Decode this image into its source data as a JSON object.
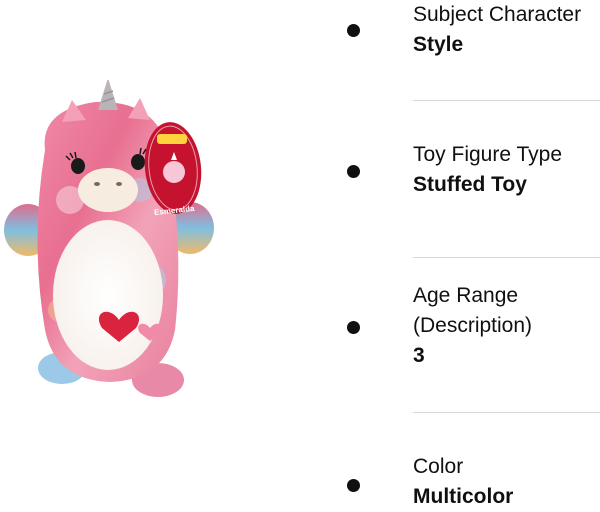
{
  "product": {
    "image_alt": "Pink tie-dye unicorn plush toy",
    "tag": {
      "brand": "HugMees",
      "sub": "Squishmallows",
      "name": "Esmeralda"
    }
  },
  "attributes": [
    {
      "label": "Subject Character",
      "value": "Style"
    },
    {
      "label": "Toy Figure Type",
      "value": "Stuffed Toy"
    },
    {
      "label": "Age Range (Description)",
      "label_lines": [
        "Age Range",
        "(Description)"
      ],
      "value": "3"
    },
    {
      "label": "Color",
      "value": "Multicolor"
    }
  ],
  "colors": {
    "text": "#0f1111",
    "divider": "#d5d9d9",
    "plush_pink": "#e8748f",
    "tag_red": "#c4122f"
  }
}
